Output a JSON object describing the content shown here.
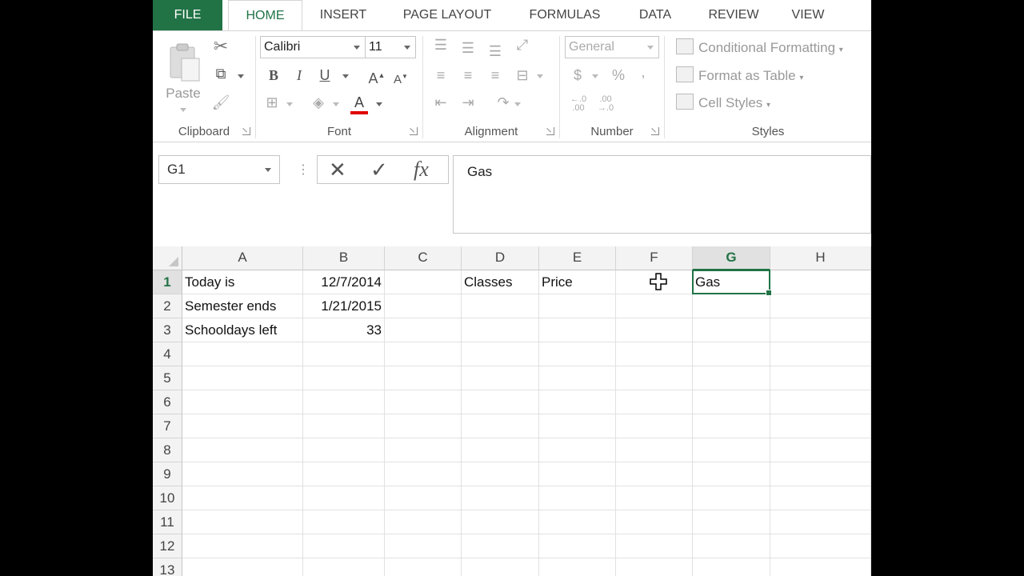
{
  "tabs": [
    "FILE",
    "HOME",
    "INSERT",
    "PAGE LAYOUT",
    "FORMULAS",
    "DATA",
    "REVIEW",
    "VIEW"
  ],
  "active_tab": "HOME",
  "ribbon": {
    "clipboard": {
      "label": "Clipboard",
      "paste_label": "Paste"
    },
    "font": {
      "label": "Font",
      "font_name": "Calibri",
      "font_size": "11",
      "bold": "B",
      "italic": "I",
      "underline": "U"
    },
    "alignment": {
      "label": "Alignment"
    },
    "number": {
      "label": "Number",
      "format": "General",
      "currency": "$",
      "percent": "%",
      "comma": ","
    },
    "styles": {
      "label": "Styles",
      "conditional": "Conditional Formatting",
      "format_table": "Format as Table",
      "cell_styles": "Cell Styles"
    }
  },
  "formula_bar": {
    "name_box": "G1",
    "cancel": "✕",
    "enter": "✓",
    "fx": "fx",
    "value": "Gas"
  },
  "columns": [
    "A",
    "B",
    "C",
    "D",
    "E",
    "F",
    "G",
    "H"
  ],
  "selected_column": "G",
  "rows": [
    "1",
    "2",
    "3",
    "4",
    "5",
    "6",
    "7",
    "8",
    "9",
    "10",
    "11",
    "12",
    "13"
  ],
  "selected_row": "1",
  "cells": {
    "A1": "Today is",
    "B1": "12/7/2014",
    "D1": "Classes",
    "E1": "Price",
    "G1": "Gas",
    "A2": "Semester ends",
    "B2": "1/21/2015",
    "A3": "Schooldays left",
    "B3": "33"
  },
  "colors": {
    "accent": "#217346",
    "font_color_bar": "#e00000"
  }
}
